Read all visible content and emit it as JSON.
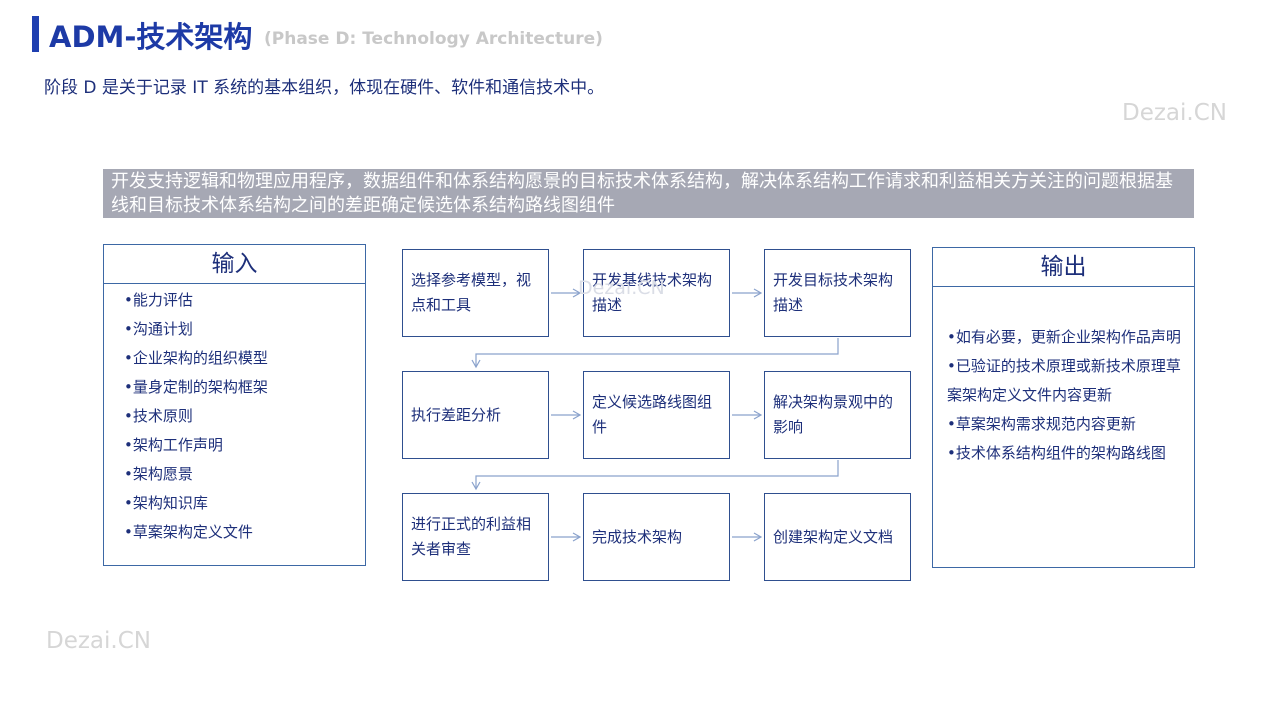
{
  "header": {
    "title": "ADM-技术架构",
    "subtitle": "(Phase D: Technology Architecture)",
    "intro": "阶段 D 是关于记录 IT 系统的基本组织，体现在硬件、软件和通信技术中。"
  },
  "watermark": "Dezai.CN",
  "banner": "开发支持逻辑和物理应用程序，数据组件和体系结构愿景的目标技术体系结构，解决体系结构工作请求和利益相关方关注的问题根据基线和目标技术体系结构之间的差距确定候选体系结构路线图组件",
  "inputs": {
    "title": "输入",
    "items": [
      "•能力评估",
      "•沟通计划",
      "•企业架构的组织模型",
      "•量身定制的架构框架",
      "•技术原则",
      "•架构工作声明",
      "•架构愿景",
      "•架构知识库",
      "•草案架构定义文件"
    ]
  },
  "steps": [
    "选择参考模型，视点和工具",
    "开发基线技术架构描述",
    "开发目标技术架构描述",
    "执行差距分析",
    "定义候选路线图组件",
    "解决架构景观中的影响",
    "进行正式的利益相关者审查",
    "完成技术架构",
    "创建架构定义文档"
  ],
  "outputs": {
    "title": "输出",
    "items": [
      "•如有必要，更新企业架构作品声明",
      "•已验证的技术原理或新技术原理草案架构定义文件内容更新",
      "•草案架构需求规范内容更新",
      "•技术体系结构组件的架构路线图"
    ]
  },
  "colors": {
    "accent": "#1f3fb0",
    "banner": "#a6a8b4",
    "border": "#3d68a5",
    "arrow": "#8aa2cc"
  }
}
